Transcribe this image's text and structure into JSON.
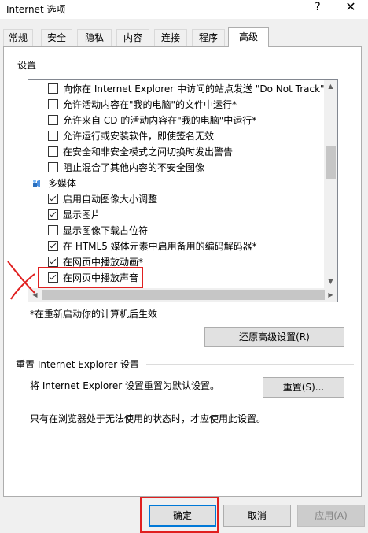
{
  "window": {
    "title": "Internet 选项",
    "help_glyph": "?",
    "close_glyph": "✕"
  },
  "tabs": [
    {
      "label": "常规",
      "active": false
    },
    {
      "label": "安全",
      "active": false
    },
    {
      "label": "隐私",
      "active": false
    },
    {
      "label": "内容",
      "active": false
    },
    {
      "label": "连接",
      "active": false
    },
    {
      "label": "程序",
      "active": false
    },
    {
      "label": "高级",
      "active": true
    }
  ],
  "settings": {
    "group_label": "设置",
    "rows": [
      {
        "type": "checkbox",
        "checked": false,
        "label": "向你在 Internet Explorer 中访问的站点发送 \"Do Not Track\""
      },
      {
        "type": "checkbox",
        "checked": false,
        "label": "允许活动内容在\"我的电脑\"的文件中运行*"
      },
      {
        "type": "checkbox",
        "checked": false,
        "label": "允许来自 CD 的活动内容在\"我的电脑\"中运行*"
      },
      {
        "type": "checkbox",
        "checked": false,
        "label": "允许运行或安装软件，即使签名无效"
      },
      {
        "type": "checkbox",
        "checked": false,
        "label": "在安全和非安全模式之间切换时发出警告"
      },
      {
        "type": "checkbox",
        "checked": false,
        "label": "阻止混合了其他内容的不安全图像"
      },
      {
        "type": "category",
        "icon": "multimedia-icon",
        "label": "多媒体"
      },
      {
        "type": "checkbox",
        "checked": true,
        "label": "启用自动图像大小调整"
      },
      {
        "type": "checkbox",
        "checked": true,
        "label": "显示图片"
      },
      {
        "type": "checkbox",
        "checked": false,
        "label": "显示图像下载占位符"
      },
      {
        "type": "checkbox",
        "checked": true,
        "label": "在 HTML5 媒体元素中启用备用的编码解码器*"
      },
      {
        "type": "checkbox",
        "checked": true,
        "label": "在网页中播放动画*"
      },
      {
        "type": "checkbox",
        "checked": true,
        "label": "在网页中播放声音",
        "highlighted": true
      }
    ],
    "restart_note": "*在重新启动你的计算机后生效",
    "restore_button": "还原高级设置(R)"
  },
  "reset": {
    "title": "重置 Internet Explorer 设置",
    "description": "将 Internet Explorer 设置重置为默认设置。",
    "button": "重置(S)...",
    "note": "只有在浏览器处于无法使用的状态时，才应使用此设置。"
  },
  "footer": {
    "ok": "确定",
    "cancel": "取消",
    "apply": "应用(A)"
  },
  "annotation_color": "#e02020"
}
